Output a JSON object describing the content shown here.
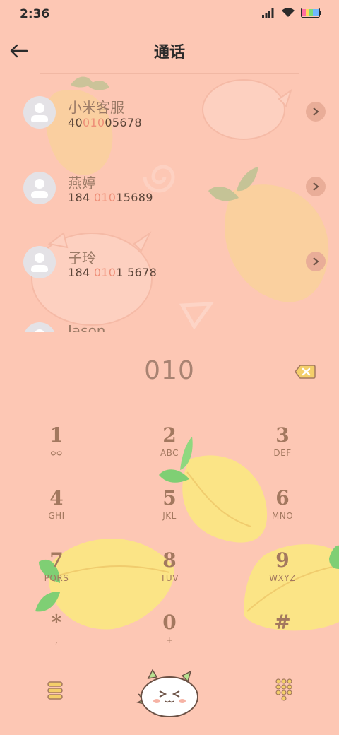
{
  "status_bar": {
    "time": "2:36",
    "icons": [
      "signal-icon",
      "wifi-icon",
      "battery-icon"
    ]
  },
  "header": {
    "title": "通话",
    "back_icon": "back-arrow-icon"
  },
  "contacts": [
    {
      "name": "小米客服",
      "number_pre": "40",
      "number_match": "010",
      "number_post": "05678"
    },
    {
      "name": "燕婷",
      "number_pre": "184 ",
      "number_match": "010",
      "number_post": "15689"
    },
    {
      "name": "子玲",
      "number_pre": "184 ",
      "number_match": "010",
      "number_post": "1 5678"
    },
    {
      "name": "Jason",
      "number_pre": "",
      "number_match": "",
      "number_post": ""
    }
  ],
  "dialer": {
    "input_value": "010",
    "keys": [
      {
        "digit": "1",
        "letters": "ᴑᴑ"
      },
      {
        "digit": "2",
        "letters": "ABC"
      },
      {
        "digit": "3",
        "letters": "DEF"
      },
      {
        "digit": "4",
        "letters": "GHI"
      },
      {
        "digit": "5",
        "letters": "JKL"
      },
      {
        "digit": "6",
        "letters": "MNO"
      },
      {
        "digit": "7",
        "letters": "PQRS"
      },
      {
        "digit": "8",
        "letters": "TUV"
      },
      {
        "digit": "9",
        "letters": "WXYZ"
      },
      {
        "digit": "*",
        "letters": ","
      },
      {
        "digit": "0",
        "letters": "+"
      },
      {
        "digit": "#",
        "letters": ""
      }
    ]
  },
  "colors": {
    "background": "#fdc7b4",
    "highlight": "#ee8f78",
    "key_text": "#a3785f",
    "lemon": "#fbe486"
  }
}
